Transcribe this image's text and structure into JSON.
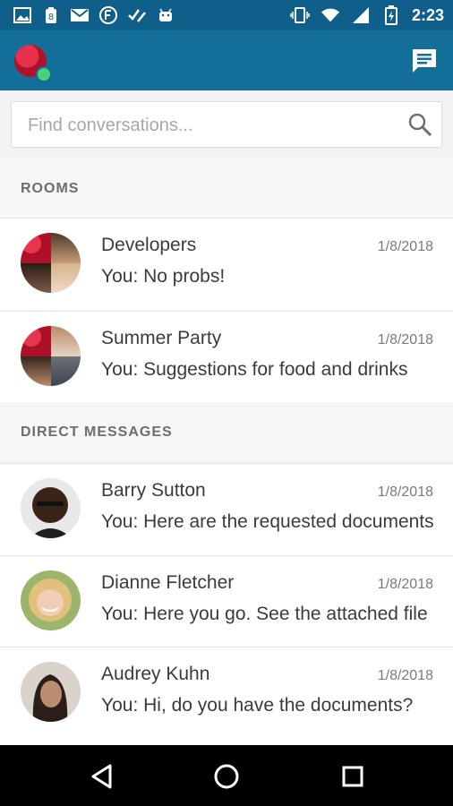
{
  "status_bar": {
    "time": "2:23",
    "left_icons": [
      "image-icon",
      "battery-saver-icon",
      "mail-icon",
      "circle-f-icon",
      "checklist-icon",
      "android-icon"
    ],
    "right_icons": [
      "vibrate-icon",
      "wifi-icon",
      "signal-icon",
      "battery-charging-icon"
    ]
  },
  "app_bar": {
    "user_status_color": "#4bd07a",
    "compose_icon": "new-chat-icon"
  },
  "search": {
    "placeholder": "Find conversations...",
    "value": ""
  },
  "sections": {
    "rooms": "ROOMS",
    "direct": "DIRECT MESSAGES"
  },
  "rooms": [
    {
      "name": "Developers",
      "date": "1/8/2018",
      "preview": "You: No probs!"
    },
    {
      "name": "Summer Party",
      "date": "1/8/2018",
      "preview": "You: Suggestions for food and drinks"
    }
  ],
  "direct_messages": [
    {
      "name": "Barry Sutton",
      "date": "1/8/2018",
      "preview": "You: Here are the requested documents"
    },
    {
      "name": "Dianne Fletcher",
      "date": "1/8/2018",
      "preview": "You: Here you go. See the attached file"
    },
    {
      "name": "Audrey Kuhn",
      "date": "1/8/2018",
      "preview": "You: Hi, do you have the documents?"
    }
  ],
  "nav": [
    "back-icon",
    "home-icon",
    "recents-icon"
  ],
  "colors": {
    "status_bar": "#0f5f8a",
    "app_bar": "#136f9a",
    "online": "#4bd07a"
  }
}
